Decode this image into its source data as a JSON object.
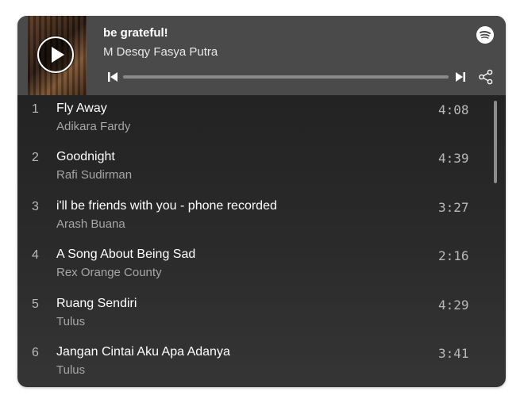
{
  "player": {
    "title": "be grateful!",
    "artist": "M Desqy Fasya Putra",
    "progress": 0
  },
  "tracks": [
    {
      "num": "1",
      "name": "Fly Away",
      "artist": "Adikara Fardy",
      "duration": "4:08"
    },
    {
      "num": "2",
      "name": "Goodnight",
      "artist": "Rafi Sudirman",
      "duration": "4:39"
    },
    {
      "num": "3",
      "name": "i'll be friends with you - phone recorded",
      "artist": "Arash Buana",
      "duration": "3:27"
    },
    {
      "num": "4",
      "name": "A Song About Being Sad",
      "artist": "Rex Orange County",
      "duration": "2:16"
    },
    {
      "num": "5",
      "name": "Ruang Sendiri",
      "artist": "Tulus",
      "duration": "4:29"
    },
    {
      "num": "6",
      "name": "Jangan Cintai Aku Apa Adanya",
      "artist": "Tulus",
      "duration": "3:41"
    }
  ],
  "icons": {
    "play": "play-icon",
    "logo": "spotify-logo-icon",
    "previous": "skip-previous-icon",
    "next": "skip-next-icon",
    "share": "share-icon"
  },
  "colors": {
    "header_bg": "#4a4a4a",
    "list_bg": "#262626",
    "text_primary": "#ffffff",
    "text_secondary": "#a6a6a6"
  }
}
